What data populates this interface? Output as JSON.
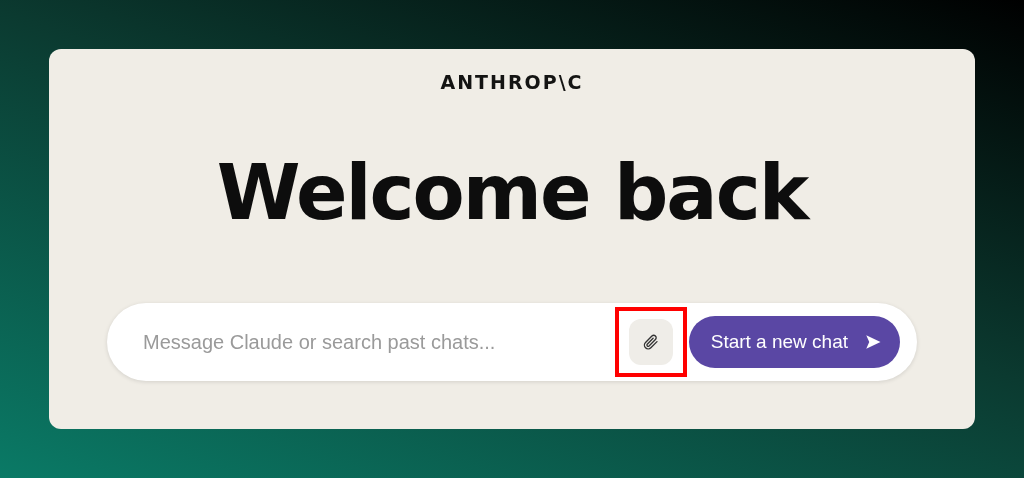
{
  "logo": "ANTHROP\\C",
  "heading": "Welcome back",
  "composer": {
    "placeholder": "Message Claude or search past chats...",
    "attach_button": {
      "highlighted": true
    },
    "submit_button": {
      "label": "Start a new chat"
    }
  }
}
